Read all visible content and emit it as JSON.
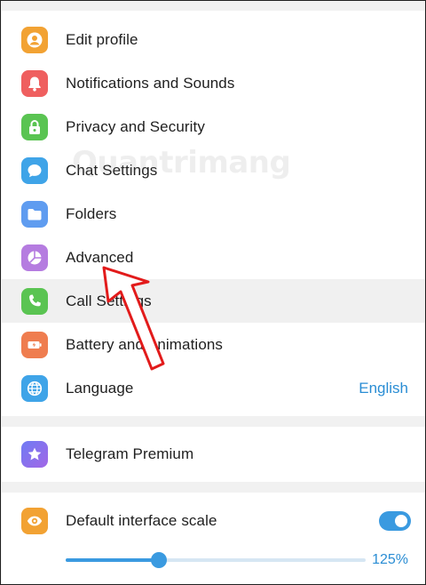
{
  "menu": {
    "items": [
      {
        "label": "Edit profile",
        "icon": "person-icon",
        "color": "#f2a233"
      },
      {
        "label": "Notifications and Sounds",
        "icon": "bell-icon",
        "color": "#ef5f5f"
      },
      {
        "label": "Privacy and Security",
        "icon": "lock-icon",
        "color": "#5ac452"
      },
      {
        "label": "Chat Settings",
        "icon": "chat-bubble-icon",
        "color": "#3fa4e8"
      },
      {
        "label": "Folders",
        "icon": "folder-icon",
        "color": "#5f9cf0"
      },
      {
        "label": "Advanced",
        "icon": "pie-chart-icon",
        "color": "#b57ce0"
      },
      {
        "label": "Call Settings",
        "icon": "phone-icon",
        "color": "#5ac452"
      },
      {
        "label": "Battery and Animations",
        "icon": "battery-icon",
        "color": "#ef7d4f"
      },
      {
        "label": "Language",
        "icon": "globe-icon",
        "color": "#3fa4e8",
        "value": "English"
      }
    ],
    "hovered": "Call Settings"
  },
  "premium": {
    "label": "Telegram Premium",
    "icon": "star-icon",
    "color": "#7a6cf0"
  },
  "scale": {
    "label": "Default interface scale",
    "icon": "eye-icon",
    "color": "#f2a233",
    "toggle_on": true,
    "value_text": "125%",
    "slider_fraction": 0.31
  },
  "watermark": "Quantrimang",
  "accent": "#3a9ae0"
}
